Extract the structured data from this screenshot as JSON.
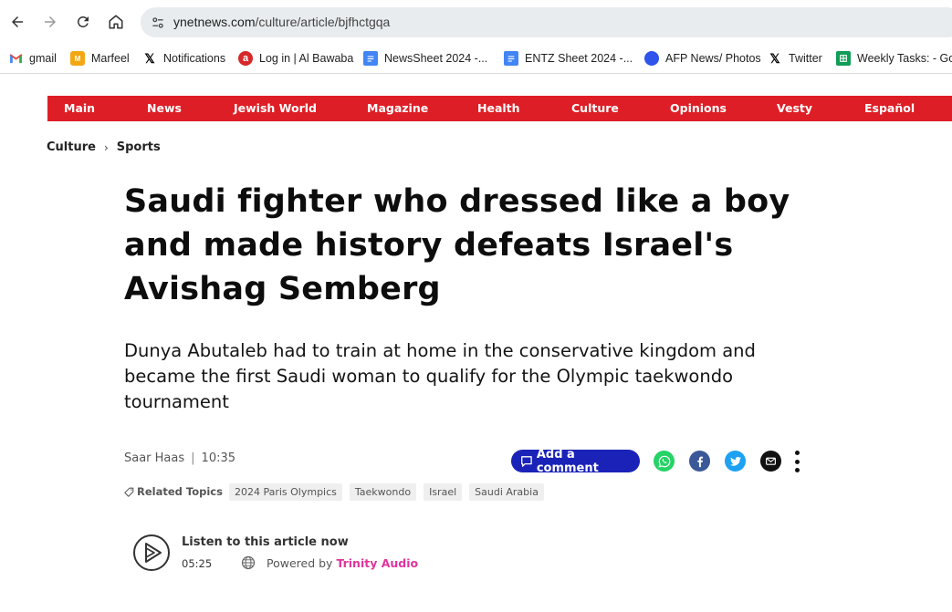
{
  "browser": {
    "url_host": "ynetnews.com",
    "url_path": "/culture/article/bjfhctgqa"
  },
  "bookmarks": [
    {
      "label": "gmail",
      "icon": "gmail-icon"
    },
    {
      "label": "Marfeel",
      "icon": "marfeel-icon"
    },
    {
      "label": "Notifications",
      "icon": "x-icon"
    },
    {
      "label": "Log in | Al Bawaba",
      "icon": "albawaba-icon"
    },
    {
      "label": "NewsSheet 2024 -...",
      "icon": "docs-icon"
    },
    {
      "label": "ENTZ Sheet 2024 -...",
      "icon": "docs-icon"
    },
    {
      "label": "AFP News/ Photos",
      "icon": "afp-icon"
    },
    {
      "label": "Twitter",
      "icon": "x-icon"
    },
    {
      "label": "Weekly Tasks: - Goo",
      "icon": "sheets-icon"
    }
  ],
  "site_nav": [
    "Main",
    "News",
    "Jewish World",
    "Magazine",
    "Health",
    "Culture",
    "Opinions",
    "Vesty",
    "Español"
  ],
  "breadcrumb": [
    "Culture",
    "Sports"
  ],
  "article": {
    "headline": "Saudi fighter who dressed like a boy and made history defeats Israel's Avishag Semberg",
    "subhead": "Dunya Abutaleb had to train at home in the conservative kingdom and became the first Saudi woman to qualify for the Olympic taekwondo tournament",
    "author": "Saar Haas",
    "time": "10:35",
    "comment_label": "Add a comment"
  },
  "related": {
    "label": "Related Topics",
    "tags": [
      "2024 Paris Olympics",
      "Taekwondo",
      "Israel",
      "Saudi Arabia"
    ]
  },
  "audio": {
    "title": "Listen to this article now",
    "duration": "05:25",
    "powered_prefix": "Powered by",
    "powered_brand": "Trinity Audio"
  },
  "colors": {
    "nav_red": "#de1e26",
    "comment_blue": "#1a22b8",
    "whatsapp": "#25d366",
    "facebook": "#3b5998",
    "twitter": "#1da1f2",
    "trinity": "#e0359c"
  }
}
